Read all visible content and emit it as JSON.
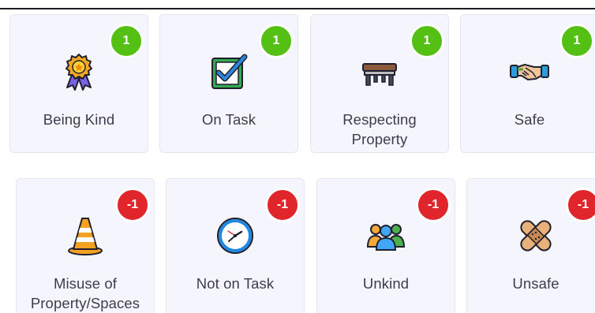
{
  "positive": [
    {
      "label": "Being Kind",
      "points": "1",
      "icon": "award-ribbon-icon"
    },
    {
      "label": "On Task",
      "points": "1",
      "icon": "checkbox-icon"
    },
    {
      "label": "Respecting Property",
      "points": "1",
      "icon": "desk-icon"
    },
    {
      "label": "Safe",
      "points": "1",
      "icon": "handshake-icon"
    }
  ],
  "negative": [
    {
      "label": "Misuse of Property/Spaces",
      "points": "-1",
      "icon": "traffic-cone-icon"
    },
    {
      "label": "Not on Task",
      "points": "-1",
      "icon": "clock-icon"
    },
    {
      "label": "Unkind",
      "points": "-1",
      "icon": "people-icon"
    },
    {
      "label": "Unsafe",
      "points": "-1",
      "icon": "bandage-icon"
    }
  ],
  "colors": {
    "positive_badge": "#54c013",
    "negative_badge": "#e0262c",
    "card_bg": "#f5f6fd",
    "label_text": "#3a3d4d"
  }
}
